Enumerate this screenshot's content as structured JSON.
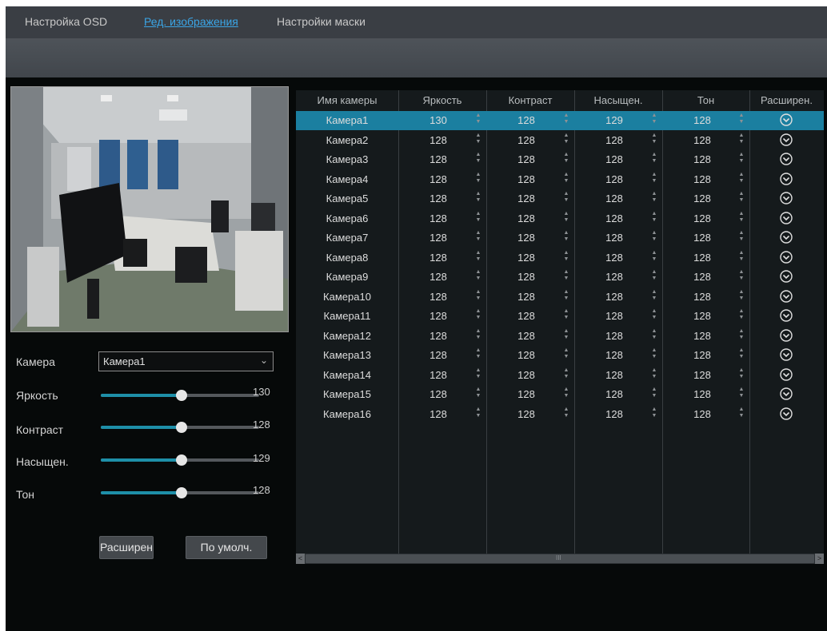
{
  "tabs": [
    {
      "label": "Настройка OSD",
      "active": false
    },
    {
      "label": "Ред. изображения",
      "active": true
    },
    {
      "label": "Настройки маски",
      "active": false
    }
  ],
  "form": {
    "camera_label": "Камера",
    "camera_value": "Камера1",
    "sliders": [
      {
        "label": "Яркость",
        "value": "130",
        "fraction": 0.51
      },
      {
        "label": "Контраст",
        "value": "128",
        "fraction": 0.51
      },
      {
        "label": "Насыщен.",
        "value": "129",
        "fraction": 0.51
      },
      {
        "label": "Тон",
        "value": "128",
        "fraction": 0.51
      }
    ],
    "advanced_button": "Расширен",
    "default_button": "По умолч."
  },
  "table": {
    "columns": [
      "Имя камеры",
      "Яркость",
      "Контраст",
      "Насыщен.",
      "Тон",
      "Расширен."
    ],
    "rows": [
      {
        "name": "Камера1",
        "brightness": "130",
        "contrast": "128",
        "saturation": "129",
        "hue": "128",
        "selected": true
      },
      {
        "name": "Камера2",
        "brightness": "128",
        "contrast": "128",
        "saturation": "128",
        "hue": "128"
      },
      {
        "name": "Камера3",
        "brightness": "128",
        "contrast": "128",
        "saturation": "128",
        "hue": "128"
      },
      {
        "name": "Камера4",
        "brightness": "128",
        "contrast": "128",
        "saturation": "128",
        "hue": "128"
      },
      {
        "name": "Камера5",
        "brightness": "128",
        "contrast": "128",
        "saturation": "128",
        "hue": "128"
      },
      {
        "name": "Камера6",
        "brightness": "128",
        "contrast": "128",
        "saturation": "128",
        "hue": "128"
      },
      {
        "name": "Камера7",
        "brightness": "128",
        "contrast": "128",
        "saturation": "128",
        "hue": "128"
      },
      {
        "name": "Камера8",
        "brightness": "128",
        "contrast": "128",
        "saturation": "128",
        "hue": "128"
      },
      {
        "name": "Камера9",
        "brightness": "128",
        "contrast": "128",
        "saturation": "128",
        "hue": "128"
      },
      {
        "name": "Камера10",
        "brightness": "128",
        "contrast": "128",
        "saturation": "128",
        "hue": "128"
      },
      {
        "name": "Камера11",
        "brightness": "128",
        "contrast": "128",
        "saturation": "128",
        "hue": "128"
      },
      {
        "name": "Камера12",
        "brightness": "128",
        "contrast": "128",
        "saturation": "128",
        "hue": "128"
      },
      {
        "name": "Камера13",
        "brightness": "128",
        "contrast": "128",
        "saturation": "128",
        "hue": "128"
      },
      {
        "name": "Камера14",
        "brightness": "128",
        "contrast": "128",
        "saturation": "128",
        "hue": "128"
      },
      {
        "name": "Камера15",
        "brightness": "128",
        "contrast": "128",
        "saturation": "128",
        "hue": "128"
      },
      {
        "name": "Камера16",
        "brightness": "128",
        "contrast": "128",
        "saturation": "128",
        "hue": "128"
      }
    ],
    "advanced_icon": "chevron-down-circle-icon",
    "spinner_icon": "up-down-spinner-icon"
  },
  "scrollbar": {
    "grip": "III",
    "left_icon": "arrow-left-icon",
    "right_icon": "arrow-right-icon"
  },
  "colors": {
    "accent": "#3ba5e6",
    "selected_row": "#1b7fa0",
    "slider_fill": "#1e8fa8",
    "background": "#060909",
    "table_bg": "#151a1c"
  }
}
